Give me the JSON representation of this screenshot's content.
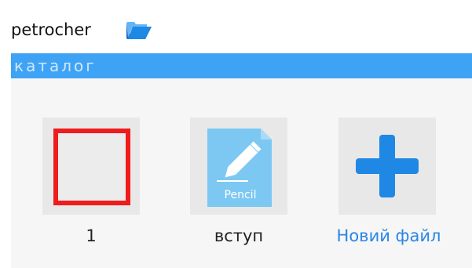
{
  "header": {
    "username": "petrocher",
    "icon": "folder-icon"
  },
  "catalog_bar": {
    "label": "каталог"
  },
  "files": [
    {
      "label": "1",
      "icon": "red-square-icon"
    },
    {
      "label": "вступ",
      "icon": "pencil-document-icon",
      "icon_text": "Pencil"
    },
    {
      "label": "Новий файл",
      "icon": "plus-icon"
    }
  ],
  "colors": {
    "accent": "#3fa3f5",
    "link": "#2a86e6",
    "square_border": "#ee1c1c",
    "plus": "#1f88e5"
  }
}
